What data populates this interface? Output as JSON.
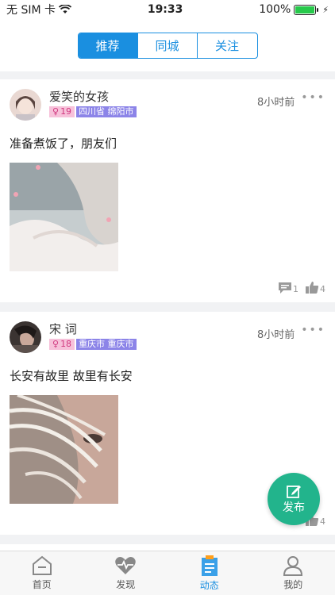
{
  "status_bar": {
    "carrier": "无 SIM 卡",
    "time": "19:33",
    "battery": "100%"
  },
  "segments": [
    {
      "label": "推荐",
      "active": true
    },
    {
      "label": "同城",
      "active": false
    },
    {
      "label": "关注",
      "active": false
    }
  ],
  "posts": [
    {
      "username": "爱笑的女孩",
      "age": "19",
      "location": "四川省 绵阳市",
      "time": "8小时前",
      "text": "准备煮饭了，朋友们",
      "comments": "1",
      "likes": "4"
    },
    {
      "username": "宋 词",
      "age": "18",
      "location": "重庆市 重庆市",
      "time": "8小时前",
      "text": "长安有故里 故里有长安",
      "comments": "",
      "likes": "4"
    }
  ],
  "fab_label": "发布",
  "tabs": [
    {
      "label": "首页",
      "icon": "home-icon",
      "active": false
    },
    {
      "label": "发现",
      "icon": "heartbeat-icon",
      "active": false
    },
    {
      "label": "动态",
      "icon": "clipboard-icon",
      "active": true
    },
    {
      "label": "我的",
      "icon": "user-icon",
      "active": false
    }
  ],
  "colors": {
    "accent": "#1a8fe0",
    "fab": "#22b48c",
    "age_tag": "#f7c1da",
    "location_tag": "#8c84e8"
  }
}
